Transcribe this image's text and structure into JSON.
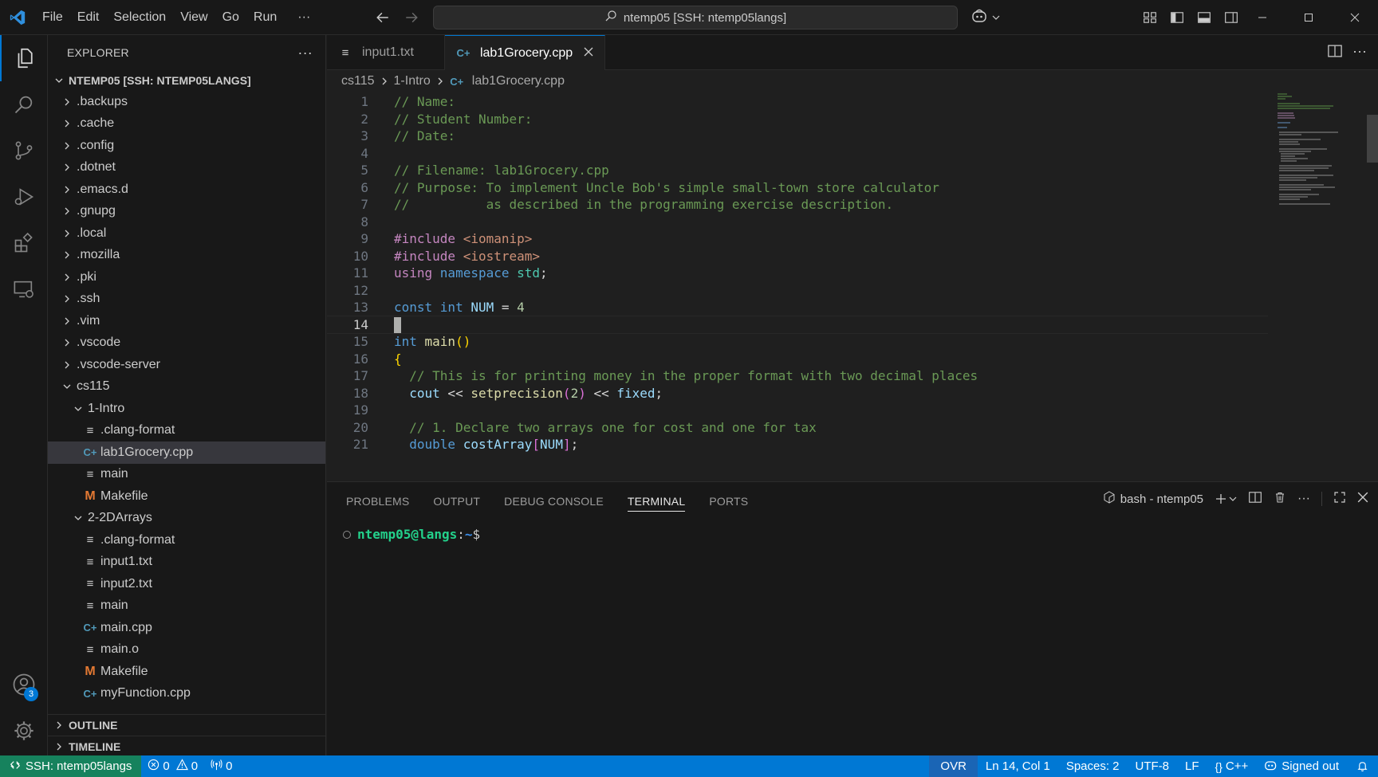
{
  "menu": [
    "File",
    "Edit",
    "Selection",
    "View",
    "Go",
    "Run",
    "···"
  ],
  "command_center": "ntemp05 [SSH: ntemp05langs]",
  "sidebar": {
    "title": "EXPLORER",
    "more": "···",
    "root": "NTEMP05 [SSH: NTEMP05LANGS]",
    "tree": [
      {
        "label": ".backups",
        "type": "folder",
        "depth": 0
      },
      {
        "label": ".cache",
        "type": "folder",
        "depth": 0
      },
      {
        "label": ".config",
        "type": "folder",
        "depth": 0
      },
      {
        "label": ".dotnet",
        "type": "folder",
        "depth": 0
      },
      {
        "label": ".emacs.d",
        "type": "folder",
        "depth": 0
      },
      {
        "label": ".gnupg",
        "type": "folder",
        "depth": 0
      },
      {
        "label": ".local",
        "type": "folder",
        "depth": 0
      },
      {
        "label": ".mozilla",
        "type": "folder",
        "depth": 0
      },
      {
        "label": ".pki",
        "type": "folder",
        "depth": 0
      },
      {
        "label": ".ssh",
        "type": "folder",
        "depth": 0
      },
      {
        "label": ".vim",
        "type": "folder",
        "depth": 0
      },
      {
        "label": ".vscode",
        "type": "folder",
        "depth": 0
      },
      {
        "label": ".vscode-server",
        "type": "folder",
        "depth": 0
      },
      {
        "label": "cs115",
        "type": "folder-open",
        "depth": 0
      },
      {
        "label": "1-Intro",
        "type": "folder-open",
        "depth": 1
      },
      {
        "label": ".clang-format",
        "type": "text",
        "depth": 2
      },
      {
        "label": "lab1Grocery.cpp",
        "type": "cpp",
        "depth": 2,
        "selected": true
      },
      {
        "label": "main",
        "type": "text",
        "depth": 2
      },
      {
        "label": "Makefile",
        "type": "make",
        "depth": 2
      },
      {
        "label": "2-2DArrays",
        "type": "folder-open",
        "depth": 1
      },
      {
        "label": ".clang-format",
        "type": "text",
        "depth": 2
      },
      {
        "label": "input1.txt",
        "type": "text",
        "depth": 2
      },
      {
        "label": "input2.txt",
        "type": "text",
        "depth": 2
      },
      {
        "label": "main",
        "type": "text",
        "depth": 2
      },
      {
        "label": "main.cpp",
        "type": "cpp",
        "depth": 2
      },
      {
        "label": "main.o",
        "type": "text",
        "depth": 2
      },
      {
        "label": "Makefile",
        "type": "make",
        "depth": 2
      },
      {
        "label": "myFunction.cpp",
        "type": "cpp",
        "depth": 2
      }
    ],
    "outline": "OUTLINE",
    "timeline": "TIMELINE"
  },
  "activity": {
    "accounts_badge": "3"
  },
  "tabs": [
    {
      "label": "input1.txt",
      "icon": "text",
      "active": false
    },
    {
      "label": "lab1Grocery.cpp",
      "icon": "cpp",
      "active": true
    }
  ],
  "breadcrumb": [
    "cs115",
    "1-Intro",
    "lab1Grocery.cpp"
  ],
  "editor": {
    "current_line": 14,
    "lines": [
      [
        [
          "c-comment",
          "// Name:"
        ]
      ],
      [
        [
          "c-comment",
          "// Student Number:"
        ]
      ],
      [
        [
          "c-comment",
          "// Date:"
        ]
      ],
      [],
      [
        [
          "c-comment",
          "// Filename: lab1Grocery.cpp"
        ]
      ],
      [
        [
          "c-comment",
          "// Purpose: To implement Uncle Bob's simple small-town store calculator"
        ]
      ],
      [
        [
          "c-comment",
          "//          as described in the programming exercise description."
        ]
      ],
      [],
      [
        [
          "c-pre",
          "#include "
        ],
        [
          "c-inc",
          "<iomanip>"
        ]
      ],
      [
        [
          "c-pre",
          "#include "
        ],
        [
          "c-inc",
          "<iostream>"
        ]
      ],
      [
        [
          "c-pre",
          "using "
        ],
        [
          "c-kw",
          "namespace "
        ],
        [
          "c-type",
          "std"
        ],
        [
          "c-txt",
          ";"
        ]
      ],
      [],
      [
        [
          "c-kw",
          "const int "
        ],
        [
          "c-var",
          "NUM"
        ],
        [
          "c-txt",
          " = "
        ],
        [
          "c-num",
          "4"
        ]
      ],
      [],
      [
        [
          "c-kw",
          "int "
        ],
        [
          "c-fn",
          "main"
        ],
        [
          "c-brace",
          "()"
        ]
      ],
      [
        [
          "c-brace",
          "{"
        ]
      ],
      [
        [
          "c-txt",
          "  "
        ],
        [
          "c-comment",
          "// This is for printing money in the proper format with two decimal places"
        ]
      ],
      [
        [
          "c-txt",
          "  "
        ],
        [
          "c-var",
          "cout"
        ],
        [
          "c-txt",
          " << "
        ],
        [
          "c-fn",
          "setprecision"
        ],
        [
          "c-paren",
          "("
        ],
        [
          "c-num",
          "2"
        ],
        [
          "c-paren",
          ")"
        ],
        [
          "c-txt",
          " << "
        ],
        [
          "c-var",
          "fixed"
        ],
        [
          "c-txt",
          ";"
        ]
      ],
      [],
      [
        [
          "c-txt",
          "  "
        ],
        [
          "c-comment",
          "// 1. Declare two arrays one for cost and one for tax"
        ]
      ],
      [
        [
          "c-txt",
          "  "
        ],
        [
          "c-kw",
          "double "
        ],
        [
          "c-var",
          "costArray"
        ],
        [
          "c-paren",
          "["
        ],
        [
          "c-var",
          "NUM"
        ],
        [
          "c-paren",
          "]"
        ],
        [
          "c-txt",
          ";"
        ]
      ]
    ]
  },
  "panel": {
    "tabs": [
      "PROBLEMS",
      "OUTPUT",
      "DEBUG CONSOLE",
      "TERMINAL",
      "PORTS"
    ],
    "active_tab": "TERMINAL",
    "terminal_name": "bash - ntemp05",
    "more": "···",
    "prompt_user": "ntemp05@langs",
    "prompt_colon": ":",
    "prompt_path": "~",
    "prompt_symbol": "$"
  },
  "status": {
    "remote": "SSH: ntemp05langs",
    "errors": "0",
    "warnings": "0",
    "ports": "0",
    "ovr": "OVR",
    "position": "Ln 14, Col 1",
    "spaces": "Spaces: 2",
    "encoding": "UTF-8",
    "eol": "LF",
    "language": "C++",
    "account": "Signed out"
  },
  "colors": {
    "accent": "#0078d4",
    "remote": "#16825d",
    "comment": "#6a9955",
    "keyword": "#569cd6"
  }
}
